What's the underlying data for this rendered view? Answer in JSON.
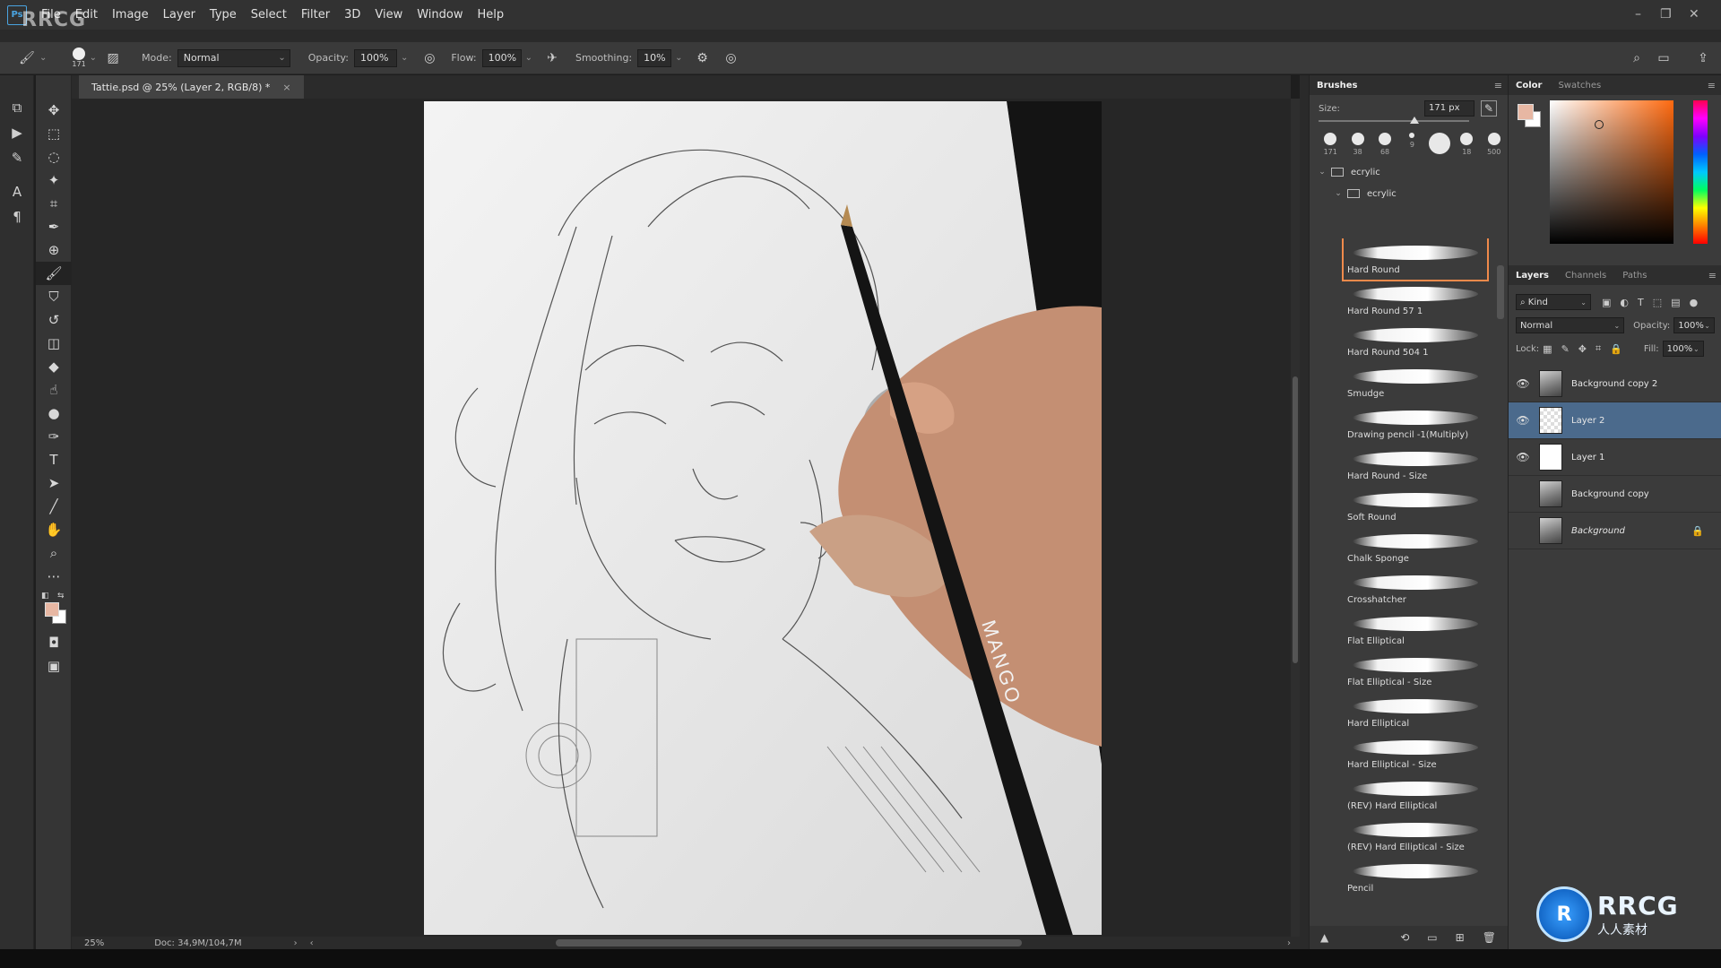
{
  "watermark": {
    "brand": "RRCG",
    "logo_text": "RRCG",
    "logo_sub": "人人素材"
  },
  "menubar": {
    "items": [
      "File",
      "Edit",
      "Image",
      "Layer",
      "Type",
      "Select",
      "Filter",
      "3D",
      "View",
      "Window",
      "Help"
    ]
  },
  "options": {
    "brush_size": "171",
    "mode_label": "Mode:",
    "mode_value": "Normal",
    "opacity_label": "Opacity:",
    "opacity_value": "100%",
    "flow_label": "Flow:",
    "flow_value": "100%",
    "smoothing_label": "Smoothing:",
    "smoothing_value": "10%"
  },
  "document": {
    "tab_title": "Tattie.psd @ 25% (Layer 2, RGB/8) *",
    "zoom": "25%",
    "doc_info": "Doc: 34,9M/104,7M",
    "pencil_brand": "MANGO"
  },
  "brushes": {
    "panel_title": "Brushes",
    "size_label": "Size:",
    "size_value": "171 px",
    "presets": [
      "171",
      "38",
      "68",
      "9",
      "",
      "18",
      "500"
    ],
    "folder_parent": "ecrylic",
    "folder_child": "ecrylic",
    "items": [
      {
        "name": "Hard Round",
        "selected": true
      },
      {
        "name": "Hard Round 57 1",
        "selected": false
      },
      {
        "name": "Hard Round 504 1",
        "selected": false
      },
      {
        "name": "Smudge",
        "selected": false
      },
      {
        "name": "Drawing pencil -1(Multiply)",
        "selected": false
      },
      {
        "name": "Hard Round - Size",
        "selected": false
      },
      {
        "name": "Soft Round",
        "selected": false
      },
      {
        "name": "Chalk Sponge",
        "selected": false
      },
      {
        "name": "Crosshatcher",
        "selected": false
      },
      {
        "name": "Flat Elliptical",
        "selected": false
      },
      {
        "name": "Flat Elliptical - Size",
        "selected": false
      },
      {
        "name": "Hard Elliptical",
        "selected": false
      },
      {
        "name": "Hard Elliptical - Size",
        "selected": false
      },
      {
        "name": "(REV) Hard Elliptical",
        "selected": false
      },
      {
        "name": "(REV) Hard Elliptical - Size",
        "selected": false
      },
      {
        "name": "Pencil",
        "selected": false
      }
    ]
  },
  "color": {
    "tabs": [
      "Color",
      "Swatches"
    ],
    "foreground": "#e7b7a3",
    "background": "#ffffff"
  },
  "layers": {
    "tabs": [
      "Layers",
      "Channels",
      "Paths"
    ],
    "kind_label": "Kind",
    "blend_mode": "Normal",
    "opacity_label": "Opacity:",
    "opacity_value": "100%",
    "lock_label": "Lock:",
    "fill_label": "Fill:",
    "fill_value": "100%",
    "rows": [
      {
        "name": "Background copy 2",
        "visible": true,
        "selected": false,
        "thumb": "photo",
        "italic": false,
        "locked": false
      },
      {
        "name": "Layer 2",
        "visible": true,
        "selected": true,
        "thumb": "trans",
        "italic": false,
        "locked": false
      },
      {
        "name": "Layer 1",
        "visible": true,
        "selected": false,
        "thumb": "white",
        "italic": false,
        "locked": false
      },
      {
        "name": "Background copy",
        "visible": false,
        "selected": false,
        "thumb": "photo",
        "italic": false,
        "locked": false
      },
      {
        "name": "Background",
        "visible": false,
        "selected": false,
        "thumb": "photo",
        "italic": true,
        "locked": true
      }
    ]
  }
}
